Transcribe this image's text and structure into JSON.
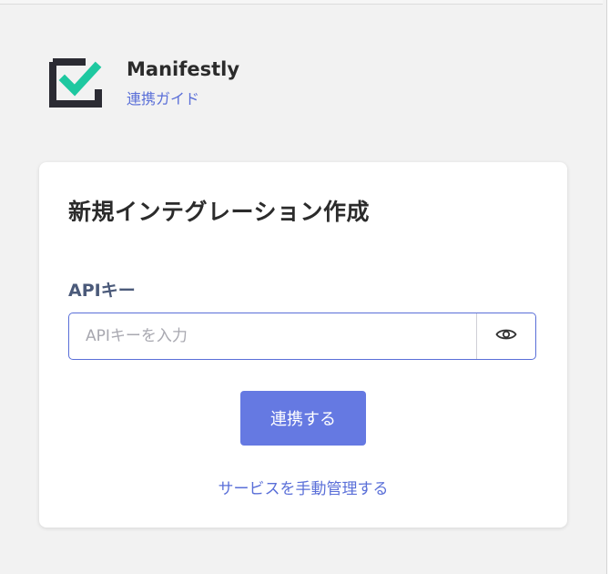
{
  "header": {
    "service_name": "Manifestly",
    "guide_link": "連携ガイド",
    "logo_icon": "manifestly-checkbox-logo",
    "logo_accent_color": "#1ec8a0",
    "logo_frame_color": "#2b2b33"
  },
  "card": {
    "title": "新規インテグレーション作成",
    "api_key_label": "APIキー",
    "api_key_value": "",
    "api_key_placeholder": "APIキーを入力",
    "visibility_toggle_icon": "eye-icon",
    "connect_button": "連携する",
    "manual_link": "サービスを手動管理する"
  },
  "colors": {
    "accent": "#6579e2",
    "link": "#5a6fd8",
    "background": "#f2f2f2"
  }
}
